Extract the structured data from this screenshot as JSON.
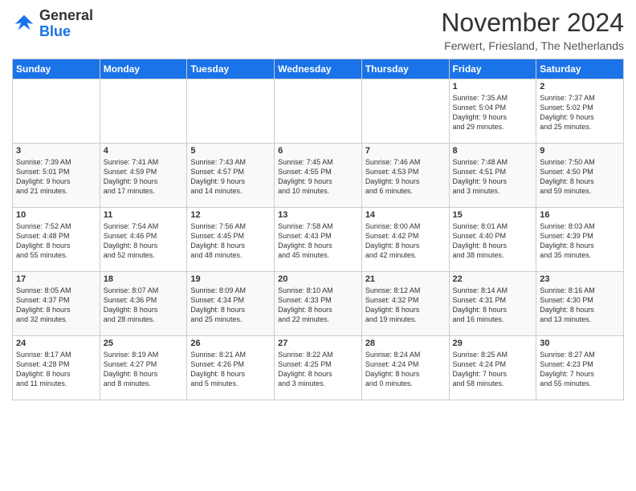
{
  "header": {
    "logo_line1": "General",
    "logo_line2": "Blue",
    "title": "November 2024",
    "location": "Ferwert, Friesland, The Netherlands"
  },
  "weekdays": [
    "Sunday",
    "Monday",
    "Tuesday",
    "Wednesday",
    "Thursday",
    "Friday",
    "Saturday"
  ],
  "weeks": [
    [
      {
        "day": "",
        "info": ""
      },
      {
        "day": "",
        "info": ""
      },
      {
        "day": "",
        "info": ""
      },
      {
        "day": "",
        "info": ""
      },
      {
        "day": "",
        "info": ""
      },
      {
        "day": "1",
        "info": "Sunrise: 7:35 AM\nSunset: 5:04 PM\nDaylight: 9 hours\nand 29 minutes."
      },
      {
        "day": "2",
        "info": "Sunrise: 7:37 AM\nSunset: 5:02 PM\nDaylight: 9 hours\nand 25 minutes."
      }
    ],
    [
      {
        "day": "3",
        "info": "Sunrise: 7:39 AM\nSunset: 5:01 PM\nDaylight: 9 hours\nand 21 minutes."
      },
      {
        "day": "4",
        "info": "Sunrise: 7:41 AM\nSunset: 4:59 PM\nDaylight: 9 hours\nand 17 minutes."
      },
      {
        "day": "5",
        "info": "Sunrise: 7:43 AM\nSunset: 4:57 PM\nDaylight: 9 hours\nand 14 minutes."
      },
      {
        "day": "6",
        "info": "Sunrise: 7:45 AM\nSunset: 4:55 PM\nDaylight: 9 hours\nand 10 minutes."
      },
      {
        "day": "7",
        "info": "Sunrise: 7:46 AM\nSunset: 4:53 PM\nDaylight: 9 hours\nand 6 minutes."
      },
      {
        "day": "8",
        "info": "Sunrise: 7:48 AM\nSunset: 4:51 PM\nDaylight: 9 hours\nand 3 minutes."
      },
      {
        "day": "9",
        "info": "Sunrise: 7:50 AM\nSunset: 4:50 PM\nDaylight: 8 hours\nand 59 minutes."
      }
    ],
    [
      {
        "day": "10",
        "info": "Sunrise: 7:52 AM\nSunset: 4:48 PM\nDaylight: 8 hours\nand 55 minutes."
      },
      {
        "day": "11",
        "info": "Sunrise: 7:54 AM\nSunset: 4:46 PM\nDaylight: 8 hours\nand 52 minutes."
      },
      {
        "day": "12",
        "info": "Sunrise: 7:56 AM\nSunset: 4:45 PM\nDaylight: 8 hours\nand 48 minutes."
      },
      {
        "day": "13",
        "info": "Sunrise: 7:58 AM\nSunset: 4:43 PM\nDaylight: 8 hours\nand 45 minutes."
      },
      {
        "day": "14",
        "info": "Sunrise: 8:00 AM\nSunset: 4:42 PM\nDaylight: 8 hours\nand 42 minutes."
      },
      {
        "day": "15",
        "info": "Sunrise: 8:01 AM\nSunset: 4:40 PM\nDaylight: 8 hours\nand 38 minutes."
      },
      {
        "day": "16",
        "info": "Sunrise: 8:03 AM\nSunset: 4:39 PM\nDaylight: 8 hours\nand 35 minutes."
      }
    ],
    [
      {
        "day": "17",
        "info": "Sunrise: 8:05 AM\nSunset: 4:37 PM\nDaylight: 8 hours\nand 32 minutes."
      },
      {
        "day": "18",
        "info": "Sunrise: 8:07 AM\nSunset: 4:36 PM\nDaylight: 8 hours\nand 28 minutes."
      },
      {
        "day": "19",
        "info": "Sunrise: 8:09 AM\nSunset: 4:34 PM\nDaylight: 8 hours\nand 25 minutes."
      },
      {
        "day": "20",
        "info": "Sunrise: 8:10 AM\nSunset: 4:33 PM\nDaylight: 8 hours\nand 22 minutes."
      },
      {
        "day": "21",
        "info": "Sunrise: 8:12 AM\nSunset: 4:32 PM\nDaylight: 8 hours\nand 19 minutes."
      },
      {
        "day": "22",
        "info": "Sunrise: 8:14 AM\nSunset: 4:31 PM\nDaylight: 8 hours\nand 16 minutes."
      },
      {
        "day": "23",
        "info": "Sunrise: 8:16 AM\nSunset: 4:30 PM\nDaylight: 8 hours\nand 13 minutes."
      }
    ],
    [
      {
        "day": "24",
        "info": "Sunrise: 8:17 AM\nSunset: 4:28 PM\nDaylight: 8 hours\nand 11 minutes."
      },
      {
        "day": "25",
        "info": "Sunrise: 8:19 AM\nSunset: 4:27 PM\nDaylight: 8 hours\nand 8 minutes."
      },
      {
        "day": "26",
        "info": "Sunrise: 8:21 AM\nSunset: 4:26 PM\nDaylight: 8 hours\nand 5 minutes."
      },
      {
        "day": "27",
        "info": "Sunrise: 8:22 AM\nSunset: 4:25 PM\nDaylight: 8 hours\nand 3 minutes."
      },
      {
        "day": "28",
        "info": "Sunrise: 8:24 AM\nSunset: 4:24 PM\nDaylight: 8 hours\nand 0 minutes."
      },
      {
        "day": "29",
        "info": "Sunrise: 8:25 AM\nSunset: 4:24 PM\nDaylight: 7 hours\nand 58 minutes."
      },
      {
        "day": "30",
        "info": "Sunrise: 8:27 AM\nSunset: 4:23 PM\nDaylight: 7 hours\nand 55 minutes."
      }
    ]
  ]
}
